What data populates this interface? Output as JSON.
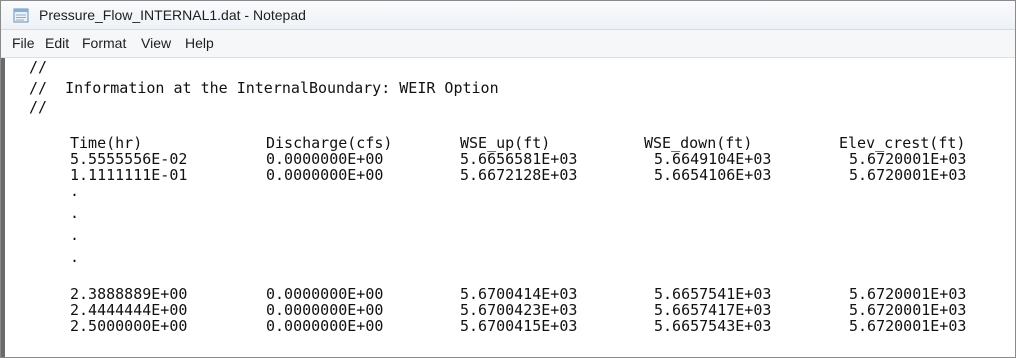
{
  "window": {
    "title": "Pressure_Flow_INTERNAL1.dat - Notepad",
    "icon": "notepad-icon"
  },
  "menu": {
    "items": [
      "File",
      "Edit",
      "Format",
      "View",
      "Help"
    ]
  },
  "editor": {
    "comment_lines": [
      "//",
      "//  Information at the InternalBoundary: WEIR Option",
      "//"
    ],
    "headers": [
      "Time(hr)",
      "Discharge(cfs)",
      "WSE_up(ft)",
      "WSE_down(ft)",
      "Elev_crest(ft)"
    ],
    "rows_top": [
      [
        "5.5555556E-02",
        "0.0000000E+00",
        "5.6656581E+03",
        "5.6649104E+03",
        "5.6720001E+03"
      ],
      [
        "1.1111111E-01",
        "0.0000000E+00",
        "5.6672128E+03",
        "5.6654106E+03",
        "5.6720001E+03"
      ]
    ],
    "ellipsis": [
      "·",
      "·",
      "·",
      "·"
    ],
    "rows_bottom": [
      [
        "2.3888889E+00",
        "0.0000000E+00",
        "5.6700414E+03",
        "5.6657541E+03",
        "5.6720001E+03"
      ],
      [
        "2.4444444E+00",
        "0.0000000E+00",
        "5.6700423E+03",
        "5.6657417E+03",
        "5.6720001E+03"
      ],
      [
        "2.5000000E+00",
        "0.0000000E+00",
        "5.6700415E+03",
        "5.6657543E+03",
        "5.6720001E+03"
      ]
    ]
  }
}
